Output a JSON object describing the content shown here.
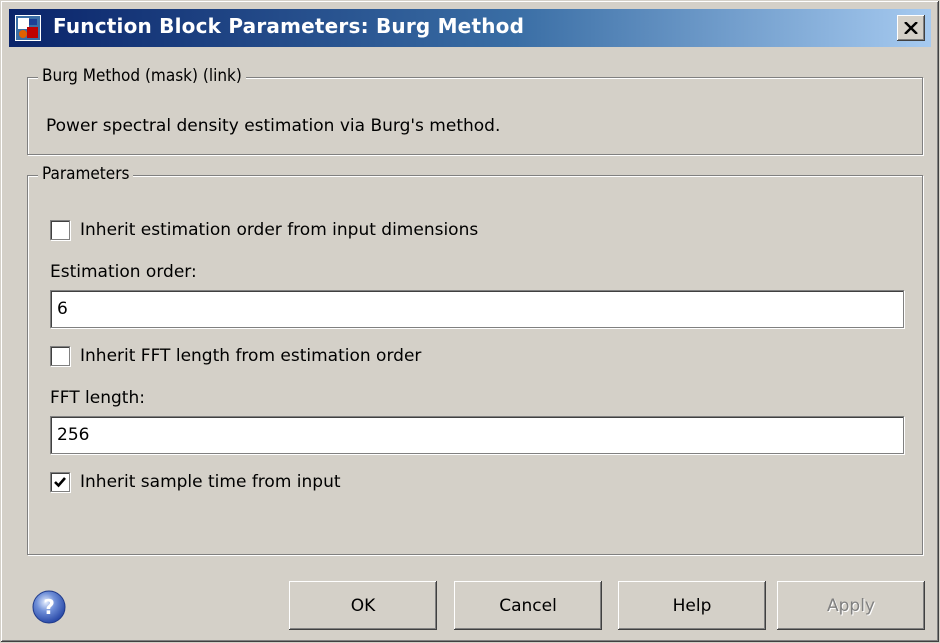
{
  "window": {
    "title": "Function Block Parameters: Burg Method",
    "icon": "simulink-block-icon",
    "close_symbol": "×"
  },
  "description_group": {
    "legend": "Burg Method (mask) (link)",
    "text": "Power spectral density estimation via Burg's method."
  },
  "parameters_group": {
    "legend": "Parameters",
    "inherit_order": {
      "label": "Inherit estimation order from input dimensions",
      "checked": false
    },
    "estimation_order": {
      "label": "Estimation order:",
      "value": "6"
    },
    "inherit_fft": {
      "label": "Inherit FFT length from estimation order",
      "checked": false
    },
    "fft_length": {
      "label": "FFT length:",
      "value": "256"
    },
    "inherit_sample_time": {
      "label": "Inherit sample time from input",
      "checked": true
    }
  },
  "buttons": {
    "ok": "OK",
    "cancel": "Cancel",
    "help": "Help",
    "apply": "Apply"
  },
  "colors": {
    "titlebar_start": "#0a246a",
    "titlebar_end": "#a6caf0",
    "window_bg": "#d4d0c8"
  }
}
